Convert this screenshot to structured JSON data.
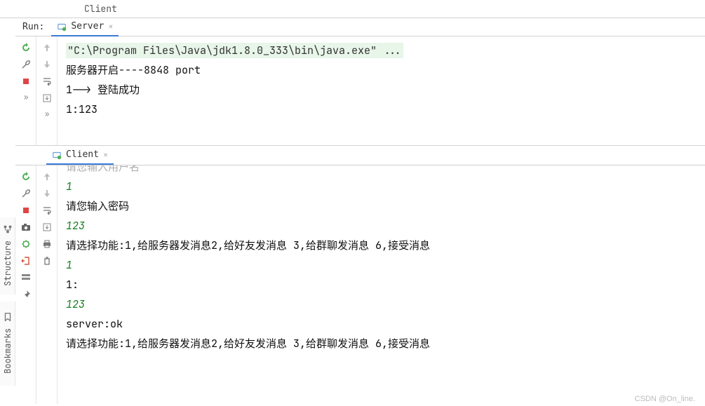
{
  "header": {
    "top_tab": "Client"
  },
  "run": {
    "label": "Run:",
    "tab_name": "Server"
  },
  "server_console": {
    "cmd": "\"C:\\Program Files\\Java\\jdk1.8.0_333\\bin\\java.exe\" ...",
    "l1": "服务器开启----8848 port",
    "l2a": "1-->",
    "l2b": " 登陆成功",
    "l3": "1:123"
  },
  "client_tab": {
    "name": "Client"
  },
  "client_console": {
    "cut": "请您输入用户名",
    "u1": "1",
    "p_prompt": "请您输入密码",
    "u2": "123",
    "menu": "请选择功能:1,给服务器发消息2,给好友发消息 3,给群聊发消息 6,接受消息",
    "u3": "1",
    "core": "1:",
    "u4": "123",
    "resp": "server:ok",
    "menu2": "请选择功能:1,给服务器发消息2,给好友发消息 3,给群聊发消息 6,接受消息"
  },
  "side": {
    "structure": "Structure",
    "bookmarks": "Bookmarks"
  },
  "watermark": "CSDN @On_line."
}
